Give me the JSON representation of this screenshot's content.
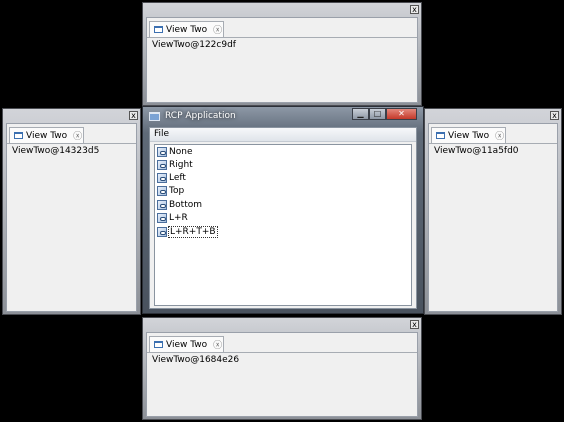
{
  "top_view": {
    "close_glyph": "x",
    "tab_label": "View Two",
    "tab_close_glyph": "ⓧ",
    "content": "ViewTwo@122c9df"
  },
  "left_view": {
    "close_glyph": "x",
    "tab_label": "View Two",
    "tab_close_glyph": "ⓧ",
    "content": "ViewTwo@14323d5"
  },
  "right_view": {
    "close_glyph": "x",
    "tab_label": "View Two",
    "tab_close_glyph": "ⓧ",
    "content": "ViewTwo@11a5fd0"
  },
  "bottom_view": {
    "close_glyph": "x",
    "tab_label": "View Two",
    "tab_close_glyph": "ⓧ",
    "content": "ViewTwo@1684e26"
  },
  "main_window": {
    "title": "RCP Application",
    "minimize_glyph": "▁",
    "maximize_glyph": "□",
    "close_glyph": "✕",
    "menu": [
      "File"
    ],
    "list_items": [
      "None",
      "Right",
      "Left",
      "Top",
      "Bottom",
      "L+R",
      "L+R+T+B"
    ],
    "selected_item": "L+R+T+B"
  },
  "colors": {
    "desktop": "#000000",
    "panel": "#f0f0f0",
    "close_button": "#c4392a"
  },
  "icons": [
    "window-icon",
    "tab-close-icon",
    "list-item-icon",
    "close-icon"
  ]
}
